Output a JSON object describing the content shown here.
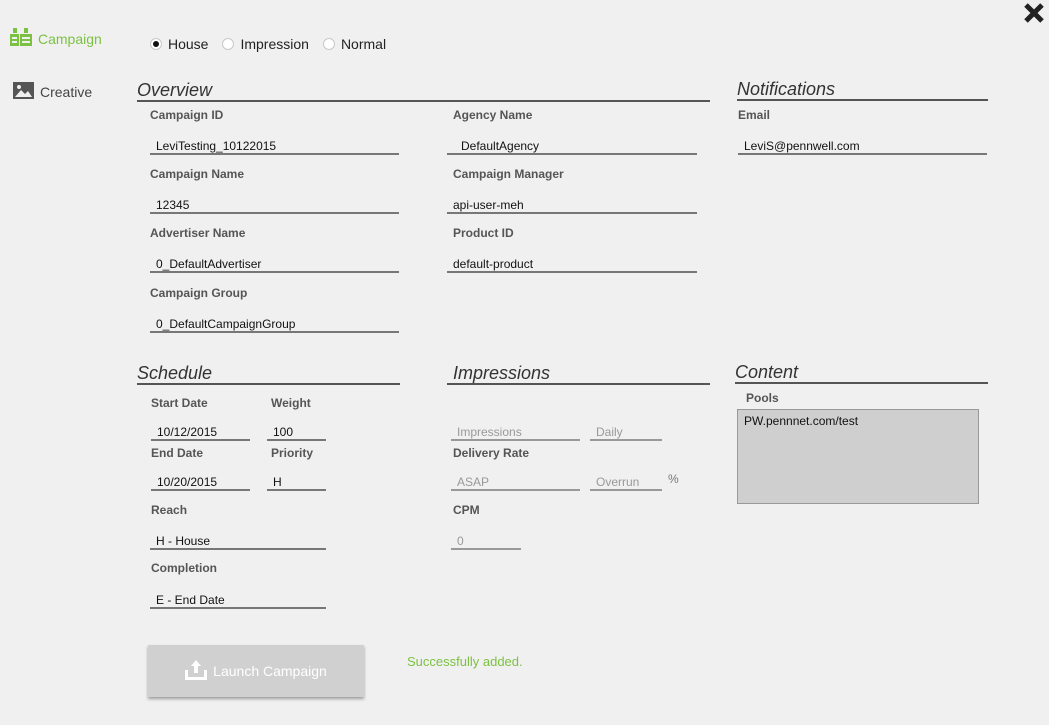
{
  "nav": {
    "campaign": "Campaign",
    "creative": "Creative"
  },
  "colors": {
    "accent": "#7cc242"
  },
  "radios": [
    {
      "label": "House",
      "checked": true
    },
    {
      "label": "Impression",
      "checked": false
    },
    {
      "label": "Normal",
      "checked": false
    }
  ],
  "overview": {
    "title": "Overview",
    "campaign_id_label": "Campaign ID",
    "campaign_id": "LeviTesting_10122015",
    "agency_name_label": "Agency Name",
    "agency_name": "DefaultAgency",
    "campaign_name_label": "Campaign Name",
    "campaign_name": "12345",
    "campaign_manager_label": "Campaign Manager",
    "campaign_manager": "api-user-meh",
    "advertiser_name_label": "Advertiser Name",
    "advertiser_name": "0_DefaultAdvertiser",
    "product_id_label": "Product ID",
    "product_id": "default-product",
    "campaign_group_label": "Campaign Group",
    "campaign_group": "0_DefaultCampaignGroup"
  },
  "notifications": {
    "title": "Notifications",
    "email_label": "Email",
    "email": "LeviS@pennwell.com"
  },
  "schedule": {
    "title": "Schedule",
    "start_date_label": "Start Date",
    "start_date": "10/12/2015",
    "weight_label": "Weight",
    "weight": "100",
    "end_date_label": "End Date",
    "end_date": "10/20/2015",
    "priority_label": "Priority",
    "priority": "H",
    "reach_label": "Reach",
    "reach": "H - House",
    "completion_label": "Completion",
    "completion": "E - End Date"
  },
  "impressions": {
    "title": "Impressions",
    "impressions_placeholder": "Impressions",
    "daily_placeholder": "Daily",
    "delivery_rate_label": "Delivery Rate",
    "asap_placeholder": "ASAP",
    "overrun_placeholder": "Overrun",
    "percent": "%",
    "cpm_label": "CPM",
    "cpm_placeholder": "0"
  },
  "content": {
    "title": "Content",
    "pools_label": "Pools",
    "pools_value": "PW.pennnet.com/test"
  },
  "launch_label": "Launch Campaign",
  "status_message": "Successfully added."
}
